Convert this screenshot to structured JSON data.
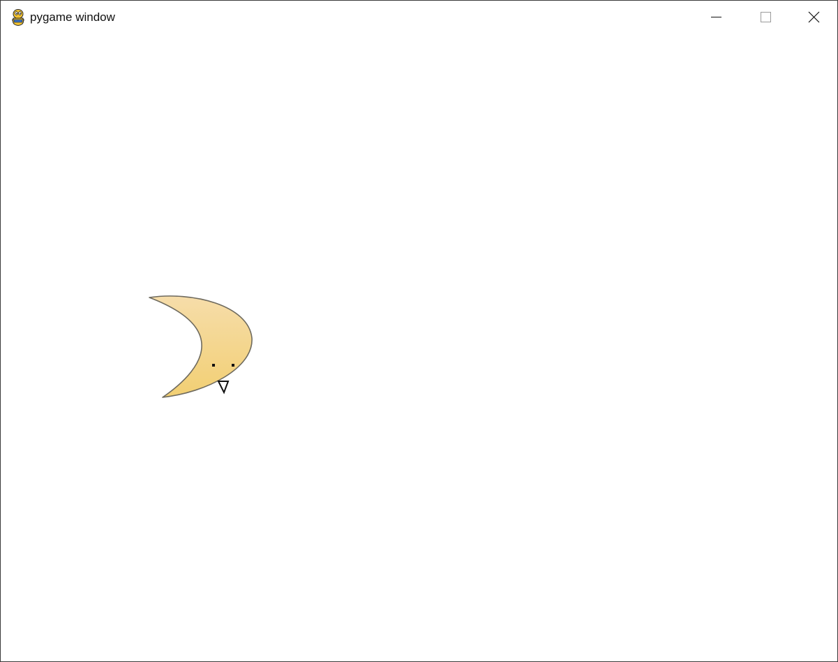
{
  "window": {
    "title": "pygame window",
    "app_icon": "pygame-snake-icon",
    "controls": {
      "minimize_icon": "minimize-icon",
      "maximize_icon": "maximize-icon",
      "close_icon": "close-icon"
    }
  },
  "scene": {
    "background_color": "#ffffff",
    "sprite": {
      "name": "crescent-moon-face",
      "fill_top": "#f6ddaa",
      "fill_bottom": "#f2cf73",
      "outline": "#6e6a5e",
      "features": [
        "left-eye",
        "right-eye",
        "triangle-nose"
      ]
    }
  }
}
